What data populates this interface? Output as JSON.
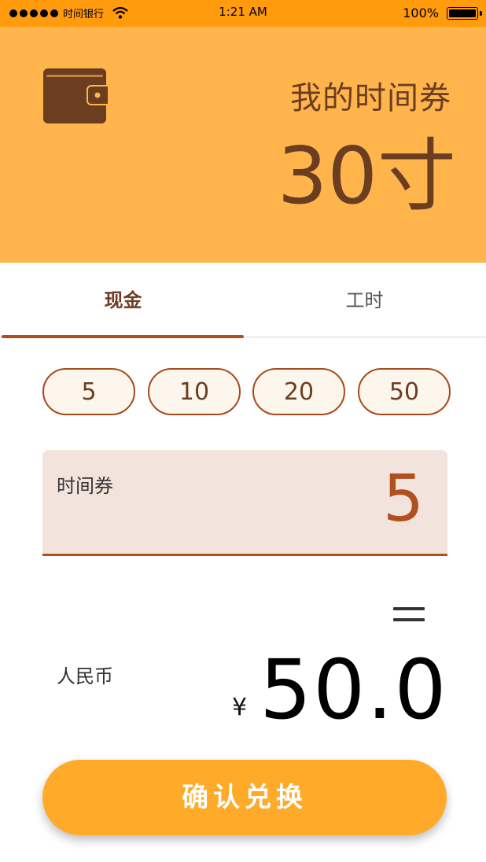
{
  "status_bar": {
    "carrier": "时间银行",
    "time": "1:21 AM",
    "battery": "100%"
  },
  "header": {
    "title": "我的时间券",
    "value": "30寸",
    "icon": "wallet-icon",
    "background": "#ffb54c",
    "text_color": "#6b3e22"
  },
  "tabs": [
    {
      "label": "现金",
      "active": true
    },
    {
      "label": "工时",
      "active": false
    }
  ],
  "amount_options": [
    "5",
    "10",
    "20",
    "50"
  ],
  "coupon_input": {
    "label": "时间券",
    "value": "5"
  },
  "result": {
    "label": "人民币",
    "currency_symbol": "¥",
    "value": "50.0"
  },
  "confirm_button": {
    "label": "确认兑换",
    "color": "#ffaa28"
  },
  "colors": {
    "accent": "#b0501e",
    "status_bar": "#ff9b0c"
  }
}
